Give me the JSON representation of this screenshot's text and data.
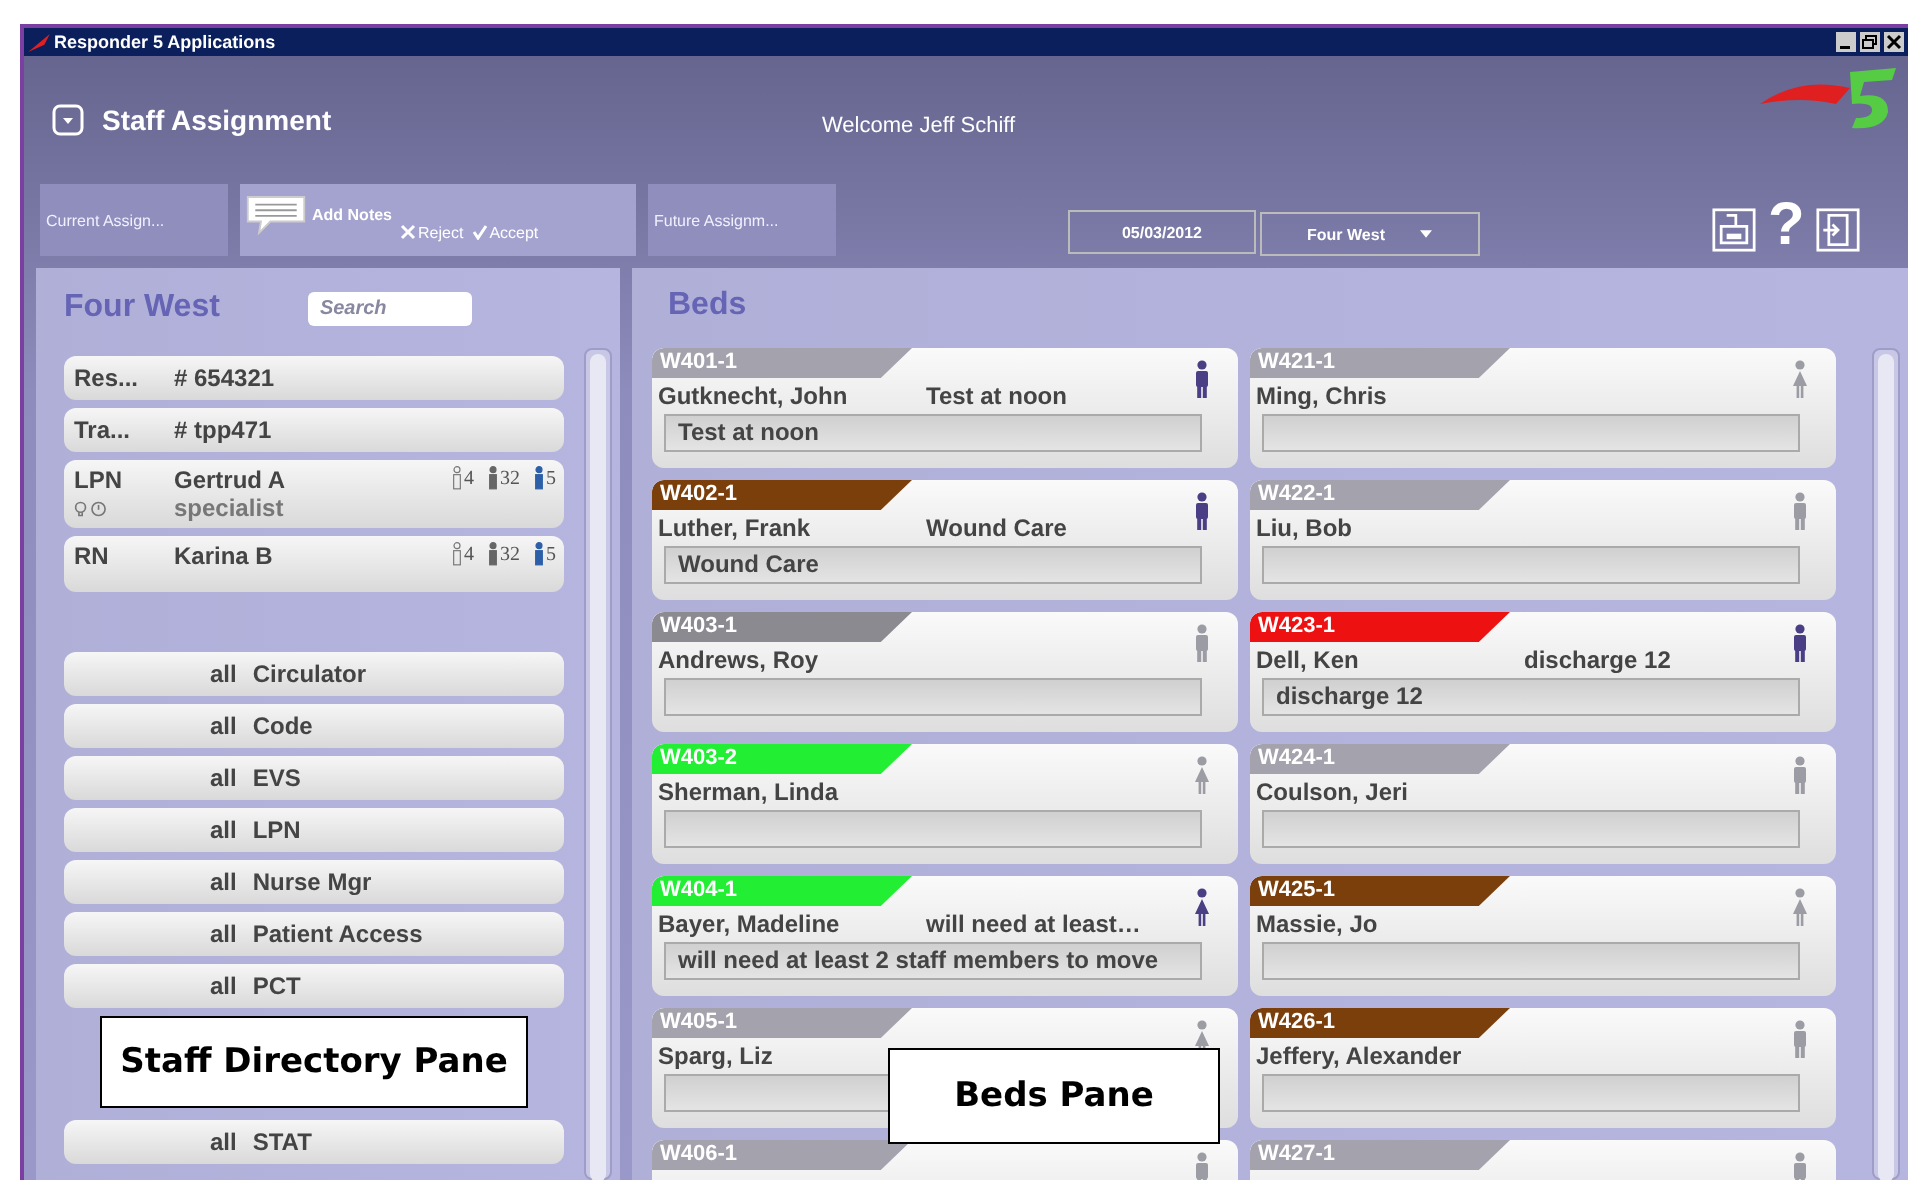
{
  "window": {
    "title": "Responder 5 Applications"
  },
  "header": {
    "title": "Staff Assignment",
    "welcome": "Welcome Jeff Schiff"
  },
  "toolbar": {
    "current": "Current Assign...",
    "add_notes": "Add Notes",
    "reject": "Reject",
    "accept": "Accept",
    "future": "Future Assignm...",
    "date": "05/03/2012",
    "unit": "Four West",
    "help": "?"
  },
  "staff_pane": {
    "title": "Four West",
    "search": {
      "placeholder": "Search"
    },
    "rows": [
      {
        "kind": "ref",
        "role": "Res...",
        "name": "# 654321"
      },
      {
        "kind": "ref",
        "role": "Tra...",
        "name": "# tpp471"
      },
      {
        "kind": "staff",
        "role": "LPN",
        "name": "Gertrud A",
        "detail": "specialist",
        "status_icons": true,
        "counts": [
          {
            "kind": "outline",
            "value": "4"
          },
          {
            "kind": "solid",
            "value": "32"
          },
          {
            "kind": "accent",
            "value": "5"
          }
        ]
      },
      {
        "kind": "staff",
        "role": "RN",
        "name": "Karina B",
        "status_icons": false,
        "counts": [
          {
            "kind": "outline",
            "value": "4"
          },
          {
            "kind": "solid",
            "value": "32"
          },
          {
            "kind": "accent",
            "value": "5"
          }
        ]
      }
    ],
    "groups_top": [
      {
        "all": "all",
        "label": "Circulator"
      },
      {
        "all": "all",
        "label": "Code"
      },
      {
        "all": "all",
        "label": "EVS"
      },
      {
        "all": "all",
        "label": "LPN"
      },
      {
        "all": "all",
        "label": "Nurse Mgr"
      },
      {
        "all": "all",
        "label": "Patient Access"
      },
      {
        "all": "all",
        "label": "PCT"
      }
    ],
    "groups_bottom": [
      {
        "all": "all",
        "label": "STAT"
      }
    ],
    "callout": "Staff Directory Pane"
  },
  "beds_pane": {
    "title": "Beds",
    "callout": "Beds Pane",
    "columns": [
      [
        {
          "bed": "W401-1",
          "color": "#a4a3ad",
          "name": "Gutknecht, John",
          "short_note": "Test at noon",
          "note": "Test at noon",
          "icon": {
            "kind": "male",
            "highlighted": true
          }
        },
        {
          "bed": "W402-1",
          "color": "#7b3f0c",
          "name": "Luther, Frank",
          "short_note": "Wound Care",
          "note": "Wound Care",
          "icon": {
            "kind": "male",
            "highlighted": true
          }
        },
        {
          "bed": "W403-1",
          "color": "#8a8a90",
          "name": "Andrews, Roy",
          "icon": {
            "kind": "male",
            "highlighted": false
          }
        },
        {
          "bed": "W403-2",
          "color": "#22ee33",
          "name": "Sherman, Linda",
          "icon": {
            "kind": "female",
            "highlighted": false
          }
        },
        {
          "bed": "W404-1",
          "color": "#22ee33",
          "name": "Bayer, Madeline",
          "short_note": "will need at least…",
          "note": "will need at least 2 staff members to move",
          "icon": {
            "kind": "female",
            "highlighted": true
          }
        },
        {
          "bed": "W405-1",
          "color": "#a4a3ad",
          "name": "Sparg, Liz",
          "icon": {
            "kind": "female",
            "highlighted": false
          }
        },
        {
          "bed": "W406-1",
          "color": "#a4a3ad",
          "icon": {
            "kind": "male",
            "highlighted": false
          }
        }
      ],
      [
        {
          "bed": "W421-1",
          "color": "#a4a3ad",
          "name": "Ming, Chris",
          "icon": {
            "kind": "female",
            "highlighted": false
          }
        },
        {
          "bed": "W422-1",
          "color": "#a4a3ad",
          "name": "Liu, Bob",
          "icon": {
            "kind": "male",
            "highlighted": false
          }
        },
        {
          "bed": "W423-1",
          "color": "#ee1111",
          "name": "Dell, Ken",
          "short_note": "discharge 12",
          "note": "discharge 12",
          "icon": {
            "kind": "male",
            "highlighted": true
          }
        },
        {
          "bed": "W424-1",
          "color": "#a4a3ad",
          "name": "Coulson, Jeri",
          "icon": {
            "kind": "male",
            "highlighted": false
          }
        },
        {
          "bed": "W425-1",
          "color": "#7b3f0c",
          "name": "Massie, Jo",
          "icon": {
            "kind": "female",
            "highlighted": false
          }
        },
        {
          "bed": "W426-1",
          "color": "#7b3f0c",
          "name": "Jeffery, Alexander",
          "icon": {
            "kind": "male",
            "highlighted": false
          }
        },
        {
          "bed": "W427-1",
          "color": "#a4a3ad",
          "icon": {
            "kind": "male",
            "highlighted": false
          }
        }
      ]
    ]
  }
}
